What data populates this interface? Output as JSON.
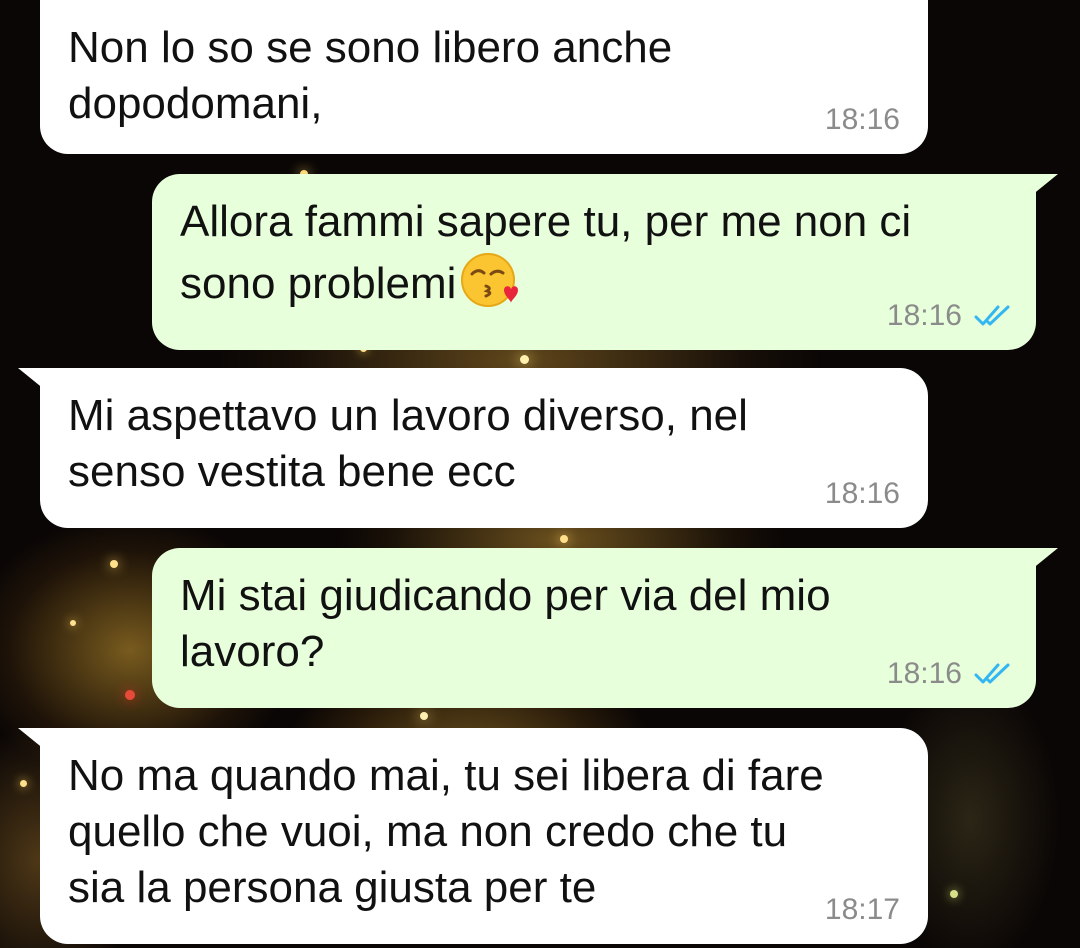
{
  "chat": {
    "messages": [
      {
        "direction": "incoming",
        "text": "Non lo so se sono libero anche dopodomani,",
        "time": "18:16"
      },
      {
        "direction": "outgoing",
        "text": "Allora fammi sapere tu, per me non ci sono problemi",
        "emoji": "face-blowing-a-kiss-emoji",
        "time": "18:16",
        "status": "read"
      },
      {
        "direction": "incoming",
        "text": "Mi aspettavo un lavoro diverso, nel senso vestita bene ecc",
        "time": "18:16"
      },
      {
        "direction": "outgoing",
        "text": "Mi stai giudicando per via del mio lavoro?",
        "time": "18:16",
        "status": "read"
      },
      {
        "direction": "incoming",
        "text": "No ma quando mai, tu sei libera di fare quello che vuoi, ma non credo che tu sia la persona giusta per te",
        "time": "18:17"
      }
    ]
  },
  "colors": {
    "incoming_bubble": "#ffffff",
    "outgoing_bubble": "#e7ffdb",
    "read_ticks": "#34b7f1",
    "timestamp": "#8b8b8b"
  }
}
